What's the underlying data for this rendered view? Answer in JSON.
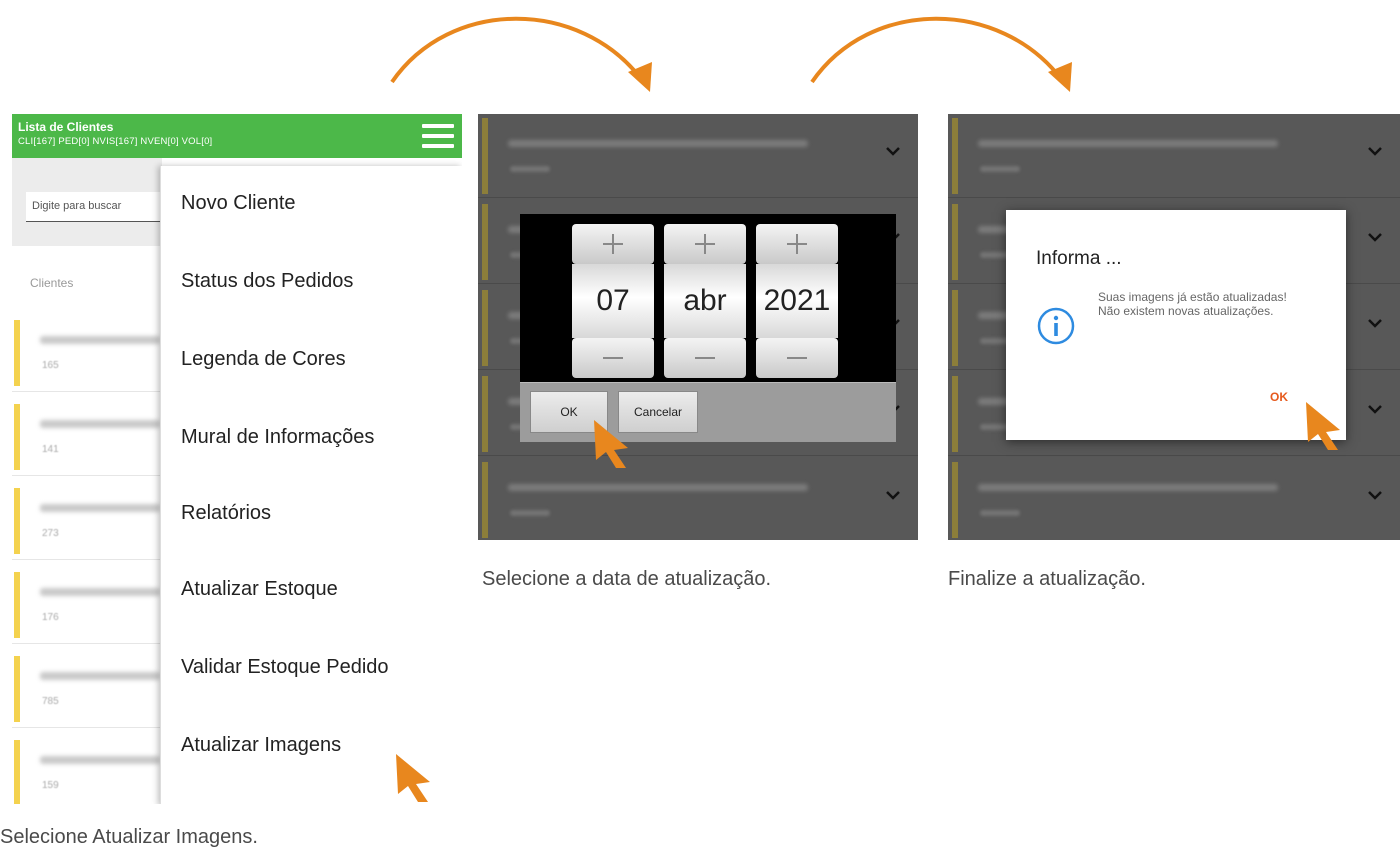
{
  "accent_green": "#4cb849",
  "accent_orange": "#e8871e",
  "panel1": {
    "title": "Lista de Clientes",
    "subtitle": "CLI[167]  PED[0]  NVIS[167]  NVEN[0]  VOL[0]",
    "search_placeholder": "Digite para buscar",
    "section_label": "Clientes",
    "clients": [
      {
        "count": "165"
      },
      {
        "count": "141"
      },
      {
        "count": "273"
      },
      {
        "count": "176"
      },
      {
        "count": "785"
      },
      {
        "count": "159"
      }
    ],
    "menu": [
      "Novo Cliente",
      "Status dos Pedidos",
      "Legenda de Cores",
      "Mural de Informações",
      "Relatórios",
      "Atualizar Estoque",
      "Validar Estoque Pedido",
      "Atualizar Imagens"
    ],
    "caption": "Selecione Atualizar Imagens."
  },
  "panel2": {
    "day": "07",
    "month": "abr",
    "year": "2021",
    "ok_label": "OK",
    "cancel_label": "Cancelar",
    "caption": "Selecione a data de atualização."
  },
  "panel3": {
    "dialog_title": "Informa ...",
    "dialog_message": "Suas imagens já estão atualizadas! Não existem novas atualizações.",
    "ok_label": "OK",
    "caption": "Finalize a atualização."
  },
  "icons": {
    "menu": "hamburger-icon",
    "plus": "plus-icon",
    "minus": "minus-icon",
    "info": "info-icon",
    "chevron": "chevron-down-icon",
    "cursor": "cursor-arrow-icon"
  }
}
